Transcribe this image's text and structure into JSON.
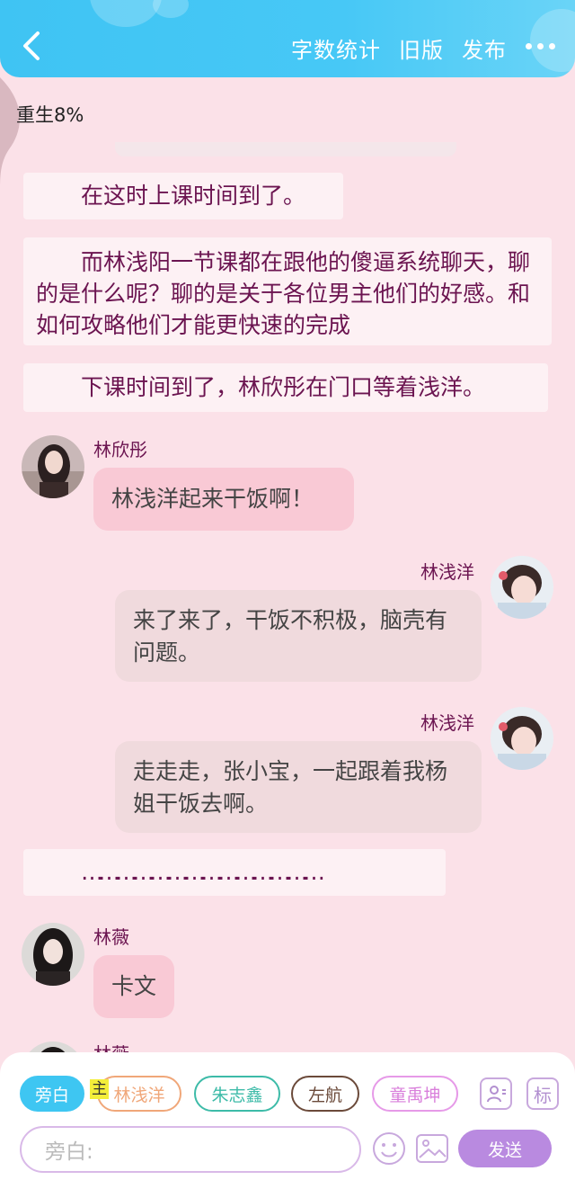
{
  "header": {
    "actions": [
      "字数统计",
      "旧版",
      "发布"
    ],
    "accent": "#47c8f6"
  },
  "doc": {
    "title": "重生8%"
  },
  "narration": [
    "在这时上课时间到了。",
    "而林浅阳一节课都在跟他的傻逼系统聊天，聊的是什么呢？聊的是关于各位男主他们的好感。和如何攻略他们才能更快速的完成",
    "下课时间到了，林欣彤在门口等着浅洋。",
    "……………………………………"
  ],
  "messages": [
    {
      "name": "林欣彤",
      "text": "林浅洋起来干饭啊！"
    },
    {
      "name": "林浅洋",
      "text": "来了来了，干饭不积极，脑壳有问题。"
    },
    {
      "name": "林浅洋",
      "text": "走走走，张小宝，一起跟着我杨姐干饭去啊。"
    },
    {
      "name": "林薇",
      "text": "卡文"
    },
    {
      "name": "林薇"
    }
  ],
  "composer": {
    "chips": [
      "旁白",
      "林浅洋",
      "朱志鑫",
      "左航",
      "童禹坤"
    ],
    "main_tag": "主",
    "label_button": "标",
    "input_placeholder": "旁白:",
    "send_label": "发送",
    "chip_colors": [
      "#3ec6f2",
      "#f0a779",
      "#3dbba8",
      "#6b4a3a",
      "#e69ae8"
    ]
  }
}
